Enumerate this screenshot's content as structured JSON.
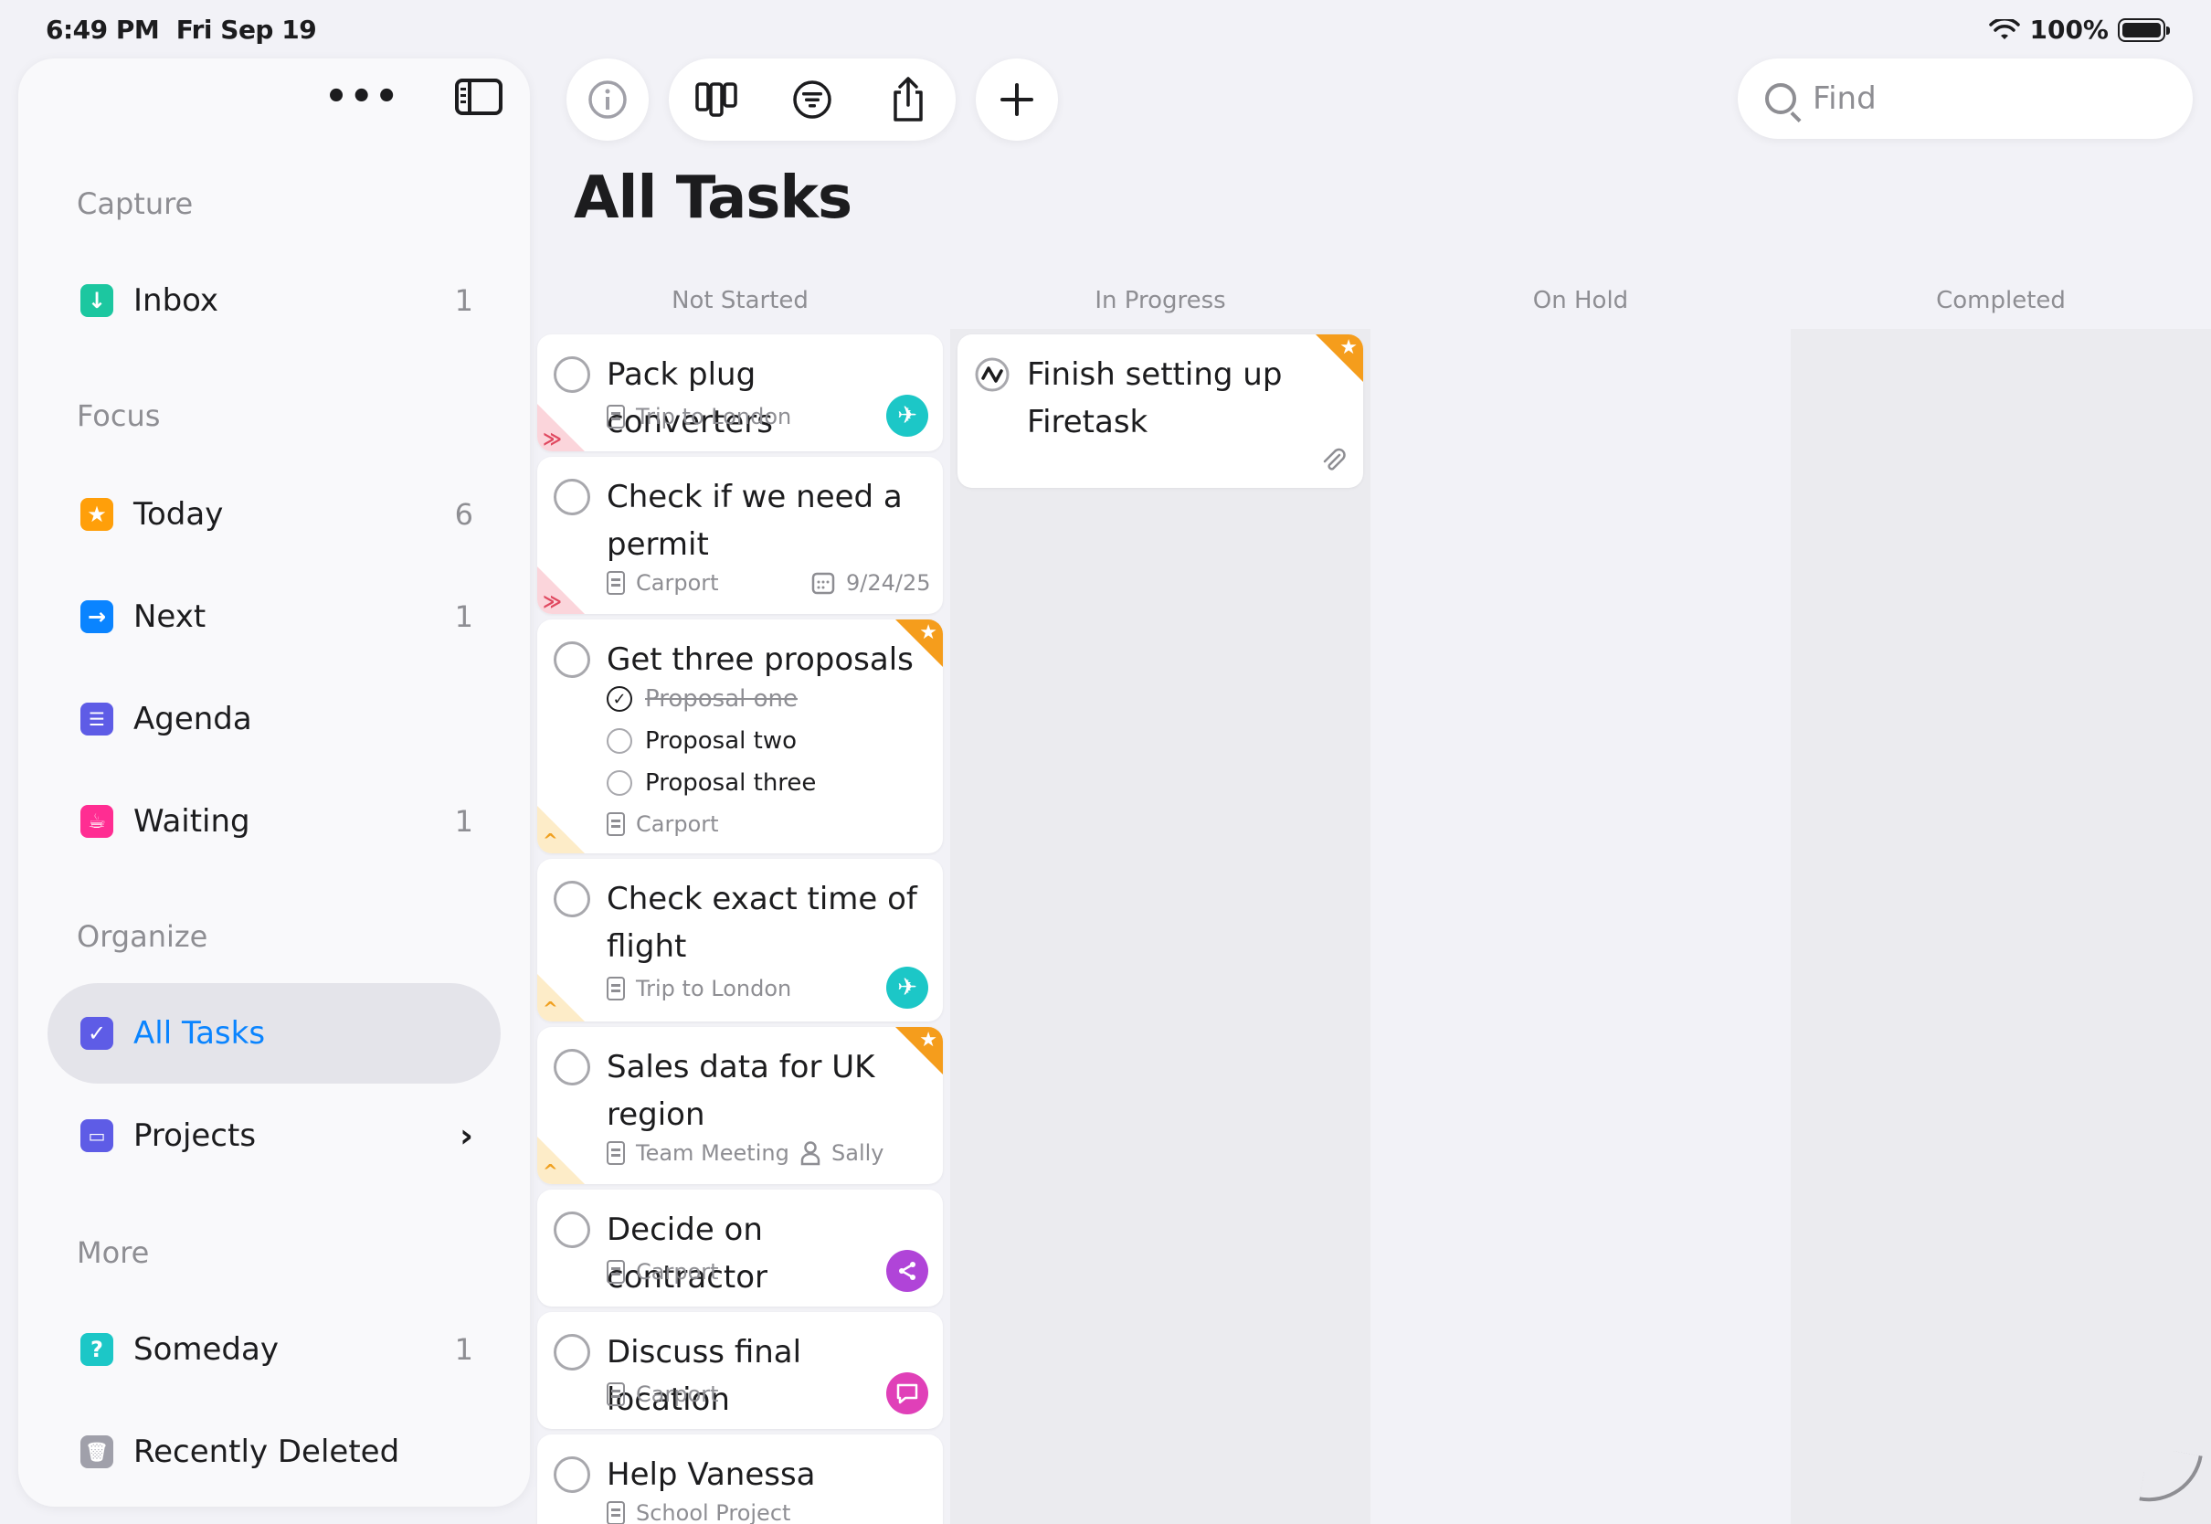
{
  "status": {
    "time": "6:49 PM",
    "date": "Fri Sep 19",
    "battery": "100%"
  },
  "sidebar": {
    "sections": {
      "capture": "Capture",
      "focus": "Focus",
      "organize": "Organize",
      "more": "More"
    },
    "items": {
      "inbox": {
        "label": "Inbox",
        "count": "1",
        "color": "#1cc7a0",
        "icon": "arrow-down-icon"
      },
      "today": {
        "label": "Today",
        "count": "6",
        "color": "#ff9f0a",
        "icon": "star-icon"
      },
      "next": {
        "label": "Next",
        "count": "1",
        "color": "#0a84ff",
        "icon": "arrow-right-icon"
      },
      "agenda": {
        "label": "Agenda",
        "count": "",
        "color": "#5e5ce6",
        "icon": "list-icon"
      },
      "waiting": {
        "label": "Waiting",
        "count": "1",
        "color": "#ff2d92",
        "icon": "cup-icon"
      },
      "all_tasks": {
        "label": "All Tasks",
        "count": "",
        "color": "#5e5ce6",
        "icon": "checkbox-icon"
      },
      "projects": {
        "label": "Projects",
        "count": "",
        "color": "#5e5ce6",
        "icon": "folder-icon"
      },
      "someday": {
        "label": "Someday",
        "count": "1",
        "color": "#1cc7c7",
        "icon": "question-icon"
      },
      "recently_deleted": {
        "label": "Recently Deleted",
        "count": "",
        "color": "#a0a0aa",
        "icon": "trash-icon"
      }
    }
  },
  "search": {
    "placeholder": "Find"
  },
  "main": {
    "title": "All Tasks",
    "columns": [
      "Not Started",
      "In Progress",
      "On Hold",
      "Completed"
    ]
  },
  "tasks": {
    "t1": {
      "title": "Pack plug converters",
      "project": "Trip to London"
    },
    "t2": {
      "title": "Check if we need a permit",
      "project": "Carport",
      "date": "9/24/25"
    },
    "t3": {
      "title": "Get three proposals",
      "project": "Carport",
      "subtasks": [
        "Proposal one",
        "Proposal two",
        "Proposal three"
      ]
    },
    "t4": {
      "title": "Check exact time of flight",
      "project": "Trip to London"
    },
    "t5": {
      "title": "Sales data for UK region",
      "project": "Team Meeting",
      "person": "Sally"
    },
    "t6": {
      "title": "Decide on contractor",
      "project": "Carport"
    },
    "t7": {
      "title": "Discuss final location",
      "project": "Carport"
    },
    "t8": {
      "title": "Help Vanessa",
      "project": "School Project"
    },
    "p1": {
      "title": "Finish setting up Firetask"
    }
  },
  "colors": {
    "accent": "#0a84ff",
    "flag": "#f59d1c",
    "trip_badge": "#1cc7c7",
    "share_badge": "#b044d8",
    "chat_badge": "#e040b8"
  }
}
